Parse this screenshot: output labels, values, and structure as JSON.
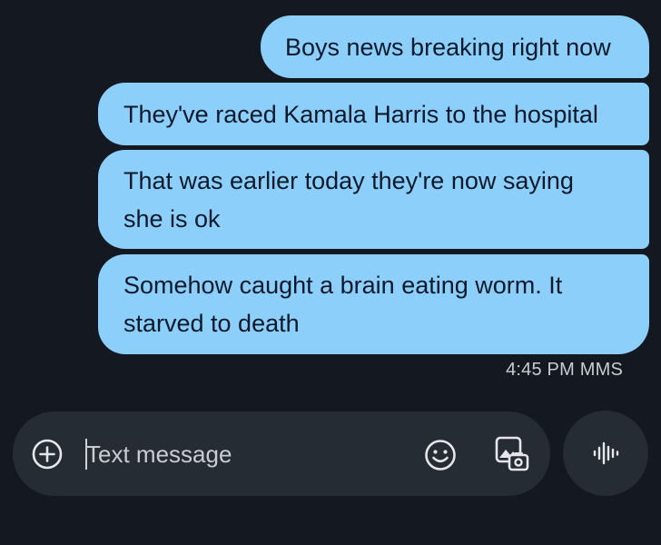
{
  "messages": [
    {
      "text": "Boys news breaking right now"
    },
    {
      "text": "They've raced Kamala Harris to the hospital"
    },
    {
      "text": "That was earlier today they're now saying she is ok"
    },
    {
      "text": "Somehow caught a brain eating worm. It starved to death"
    }
  ],
  "meta": {
    "time": "4:45 PM",
    "type": "MMS"
  },
  "composer": {
    "placeholder": "Text message",
    "icons": [
      "add-icon",
      "emoji-icon",
      "gallery-icon",
      "voice-icon"
    ]
  },
  "colors": {
    "background": "#141820",
    "bubble": "#8ccffb",
    "composer": "#262c33"
  }
}
